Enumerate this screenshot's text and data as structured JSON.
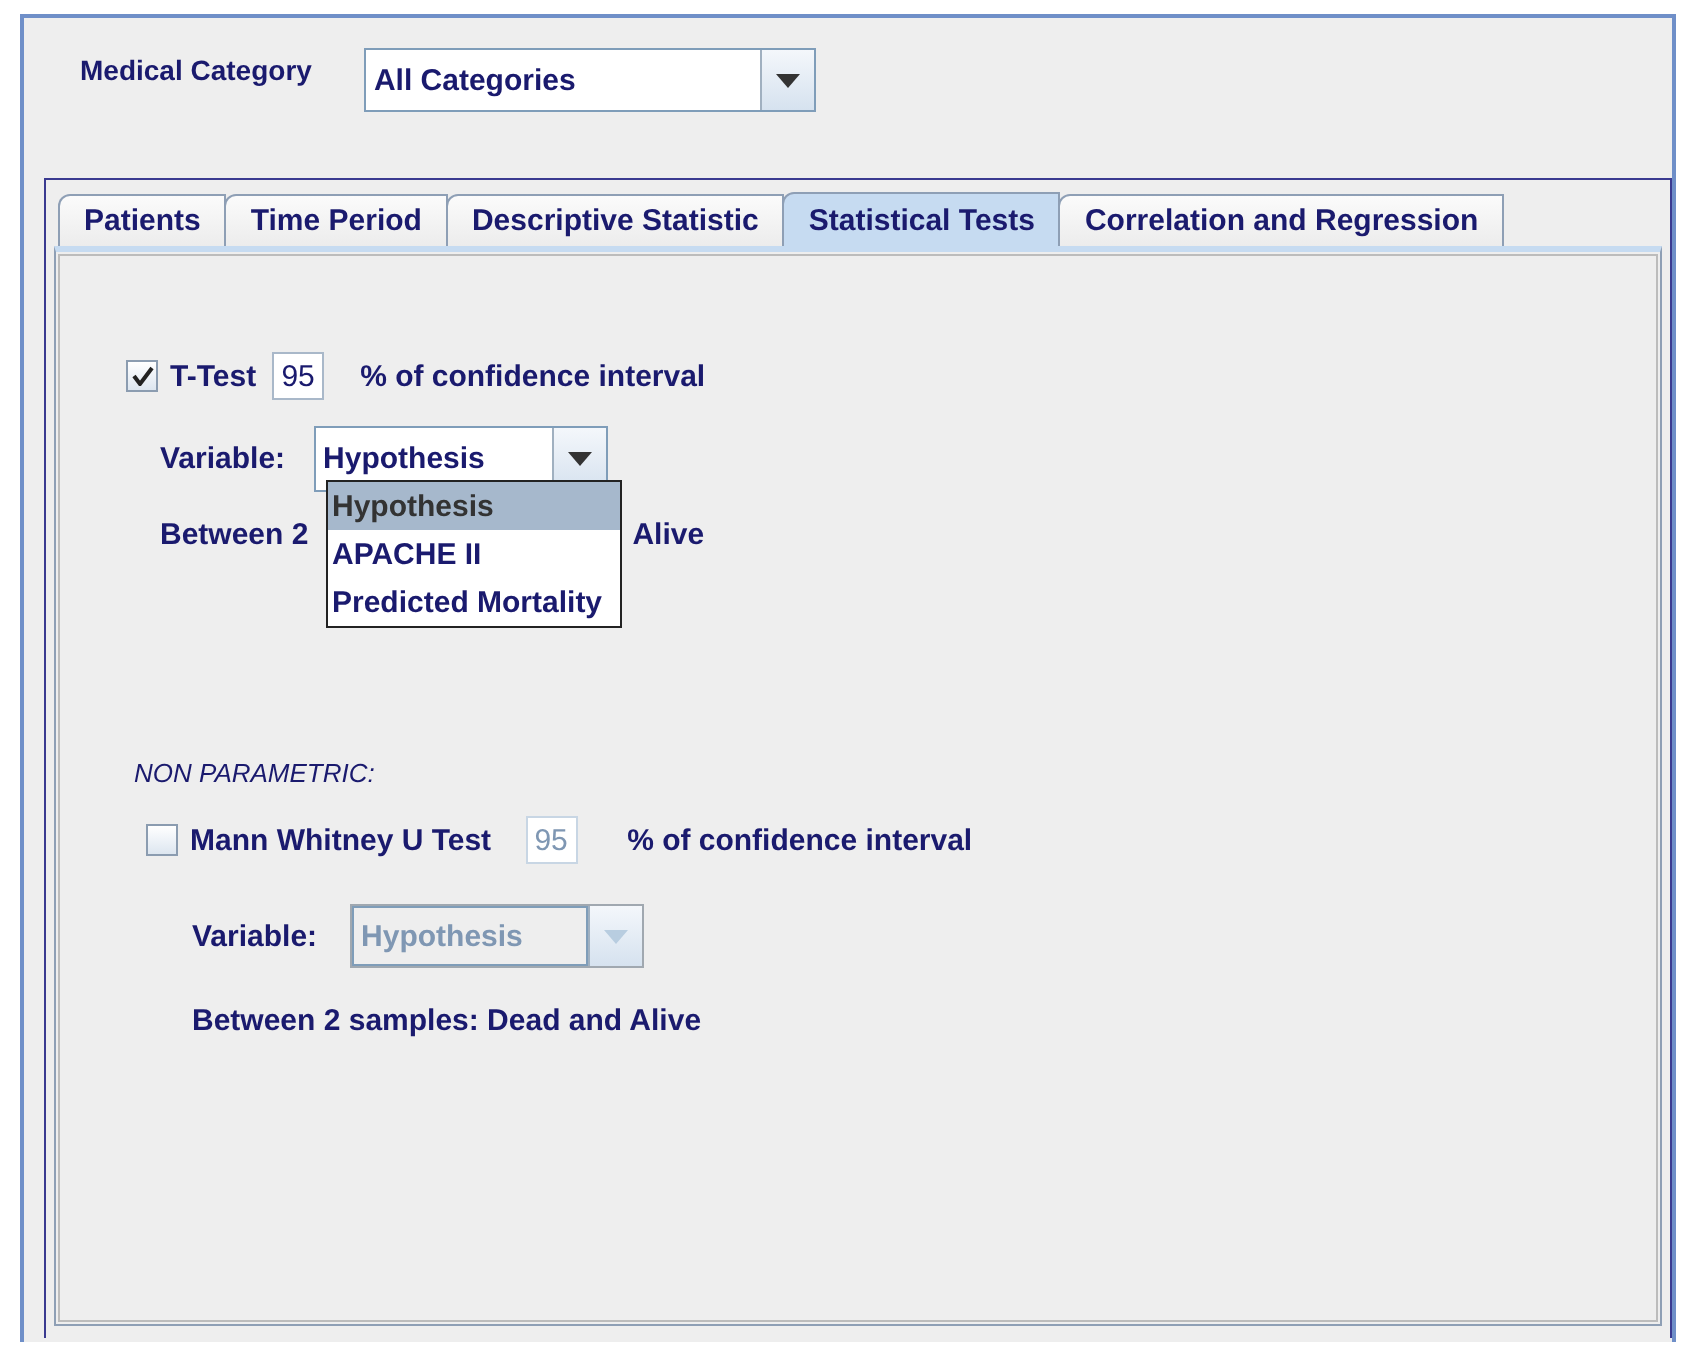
{
  "medical_category": {
    "label": "Medical Category",
    "value": "All Categories"
  },
  "tabs": [
    {
      "label": "Patients",
      "selected": false
    },
    {
      "label": "Time Period",
      "selected": false
    },
    {
      "label": "Descriptive Statistic",
      "selected": false
    },
    {
      "label": "Statistical Tests",
      "selected": true
    },
    {
      "label": "Correlation and Regression",
      "selected": false
    }
  ],
  "t_test": {
    "label": "T-Test",
    "checked": true,
    "disabled": false,
    "confidence": "95",
    "confidence_label": "% of confidence interval",
    "variable_label": "Variable:",
    "variable": "Hypothesis",
    "expanded": true,
    "options": [
      {
        "label": "Hypothesis",
        "selected": true
      },
      {
        "label": "APACHE II",
        "selected": false
      },
      {
        "label": "Predicted Mortality",
        "selected": false
      }
    ],
    "samples_left": "Between 2",
    "samples_right": "Alive"
  },
  "non_parametric": {
    "heading": "NON PARAMETRIC:",
    "label": "Mann Whitney U Test",
    "checked": false,
    "disabled": true,
    "confidence": "95",
    "confidence_label": "% of confidence interval",
    "variable_label": "Variable:",
    "variable": "Hypothesis",
    "samples": "Between 2 samples: Dead and Alive"
  }
}
